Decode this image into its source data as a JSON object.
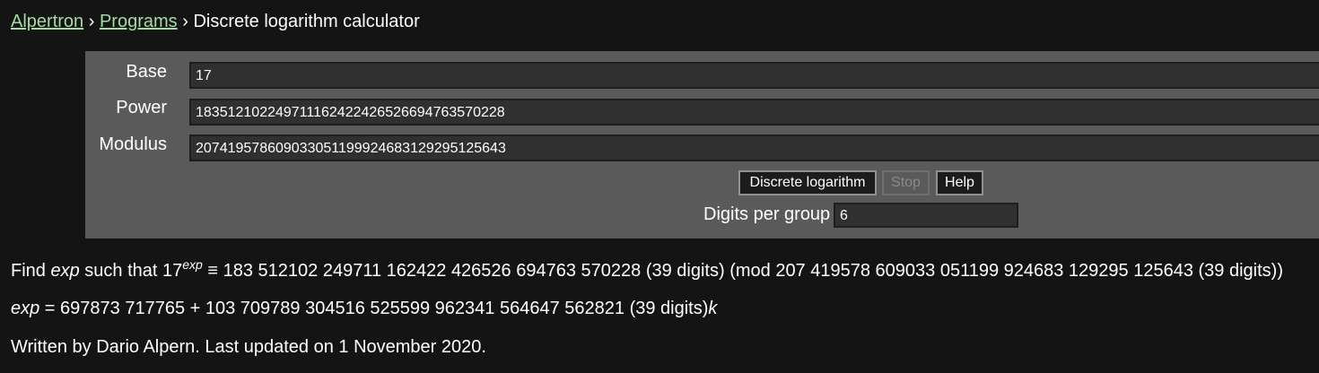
{
  "breadcrumb": {
    "home": "Alpertron",
    "sep1": "›",
    "programs": "Programs",
    "sep2": "›",
    "current": "Discrete logarithm calculator"
  },
  "form": {
    "base_label": "Base",
    "base_value": "17",
    "power_label": "Power",
    "power_value": "183512102249711162422426526694763570228",
    "modulus_label": "Modulus",
    "modulus_value": "207419578609033051199924683129295125643",
    "discrete_log_button": "Discrete logarithm",
    "stop_button": "Stop",
    "help_button": "Help",
    "digits_per_group_label": "Digits per group",
    "digits_per_group_value": "6"
  },
  "result": {
    "find_prefix": "Find ",
    "exp_word": "exp",
    "find_middle": " such that 17",
    "exponent": "exp",
    "find_rest": " ≡ 183 512102 249711 162422 426526 694763 570228 (39 digits) (mod 207 419578 609033 051199 924683 129295 125643 (39 digits))",
    "solution_exp": "exp",
    "solution_text": " = 697873 717765 + 103 709789 304516 525599 962341 564647 562821 (39 digits)",
    "solution_k": "k",
    "footer": "Written by Dario Alpern. Last updated on 1 November 2020."
  },
  "colors": {
    "background": "#141414",
    "panel": "#5a5a5a",
    "link": "#a3dca3",
    "field": "#303030"
  }
}
